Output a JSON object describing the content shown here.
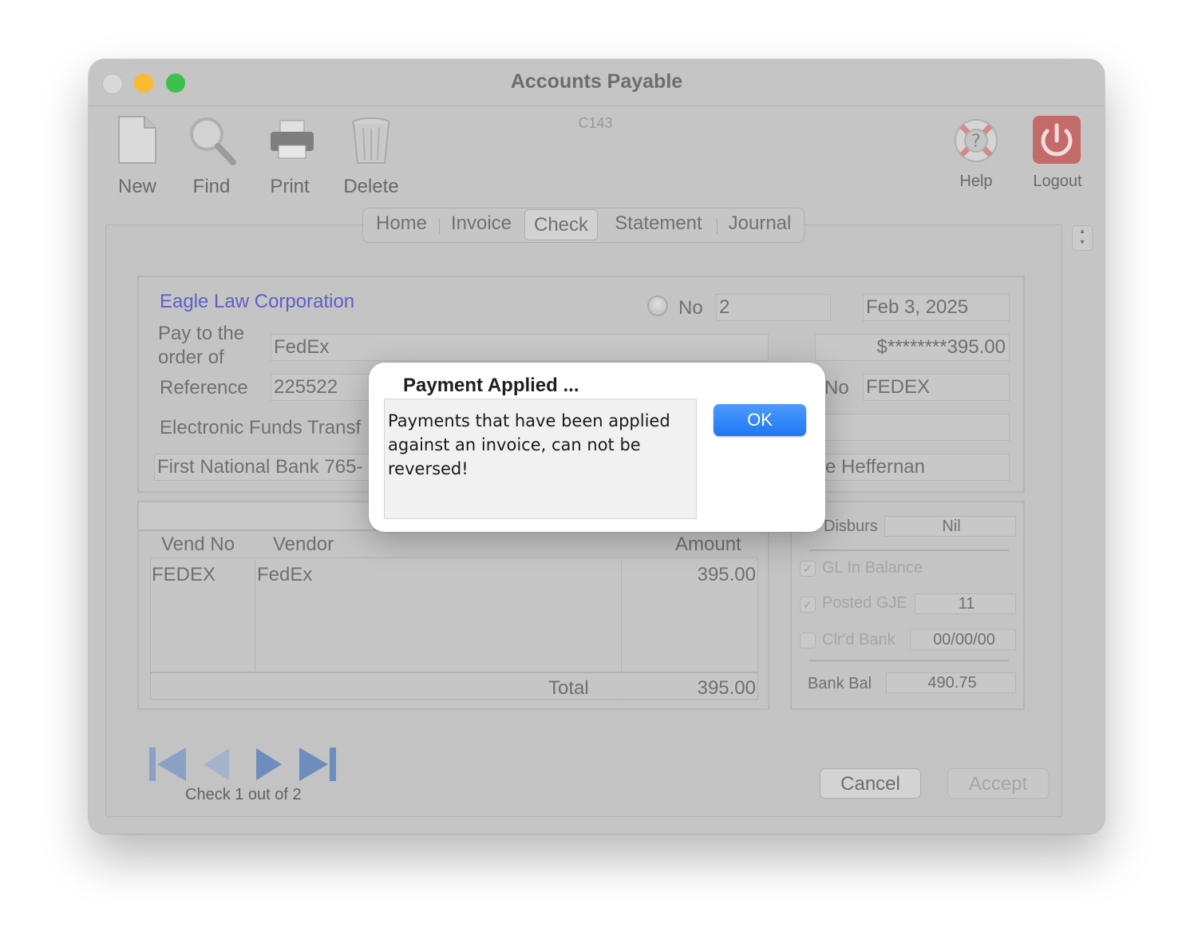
{
  "window": {
    "title": "Accounts Payable",
    "screen_code": "C143"
  },
  "toolbar": {
    "new": "New",
    "find": "Find",
    "print": "Print",
    "delete": "Delete",
    "help": "Help",
    "logout": "Logout"
  },
  "tabs": [
    "Home",
    "Invoice",
    "Check",
    "Statement",
    "Journal"
  ],
  "active_tab": "Check",
  "check": {
    "company": "Eagle Law Corporation",
    "no_label": "No",
    "no_value": "2",
    "date": "Feb 3, 2025",
    "pay_to_label_1": "Pay to the",
    "pay_to_label_2": "order of",
    "payee": "FedEx",
    "amount": "$********395.00",
    "reference_label": "Reference",
    "reference": "225522",
    "vend_no_label": "No",
    "vend_no": "FEDEX",
    "eft_label": "Electronic Funds Transf",
    "bank": "First National Bank 765-",
    "signer": "e Heffernan"
  },
  "grid": {
    "headers": {
      "vend_no": "Vend No",
      "vendor": "Vendor",
      "amount": "Amount"
    },
    "rows": [
      {
        "vend_no": "FEDEX",
        "vendor": "FedEx",
        "amount": "395.00"
      }
    ],
    "total_label": "Total",
    "total": "395.00"
  },
  "side": {
    "disburs_label": "Disburs",
    "disburs": "Nil",
    "gl_balance_label": "GL In Balance",
    "posted_gje_label": "Posted GJE",
    "posted_gje": "11",
    "clrd_bank_label": "Clr'd Bank",
    "clrd_bank": "00/00/00",
    "bank_bal_label": "Bank Bal",
    "bank_bal": "490.75"
  },
  "nav": {
    "status": "Check 1 out of 2"
  },
  "buttons": {
    "cancel": "Cancel",
    "accept": "Accept"
  },
  "dialog": {
    "title": "Payment Applied ...",
    "message": "Payments that have been applied against an invoice, can not be reversed!",
    "ok": "OK"
  },
  "colors": {
    "company_link": "#5f5fc6",
    "ok_button": "#2a7ff5",
    "close_red_dim": "#d8d8d8",
    "minimize_yellow": "#f8bb32",
    "zoom_green": "#3dc14a"
  }
}
